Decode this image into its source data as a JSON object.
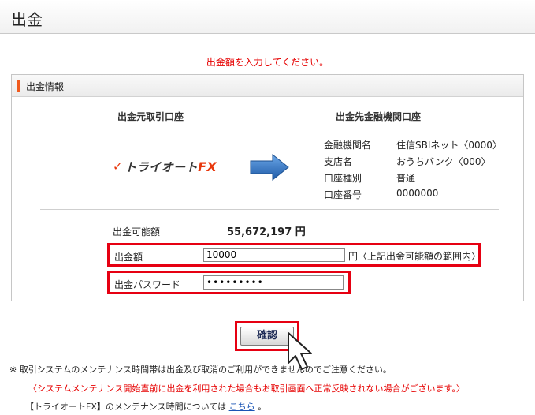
{
  "page": {
    "title": "出金"
  },
  "instruction": "出金額を入力してください。",
  "panel": {
    "title": "出金情報",
    "source_header": "出金元取引口座",
    "dest_header": "出金先金融機関口座",
    "logo": {
      "brand": "トライオート",
      "suffix": "FX"
    },
    "bank": [
      {
        "key": "金融機関名",
        "value": "住信SBIネット〈0000〉"
      },
      {
        "key": "支店名",
        "value": "おうちバンク〈000〉"
      },
      {
        "key": "口座種別",
        "value": "普通"
      },
      {
        "key": "口座番号",
        "value": "0000000"
      }
    ],
    "available_label": "出金可能額",
    "available_value": "55,672,197 円",
    "amount_label": "出金額",
    "amount_value": "10000",
    "amount_unit_note": "円〈上記出金可能額の範囲内〉",
    "password_label": "出金パスワード",
    "password_value": "•••••••••"
  },
  "confirm_label": "確認",
  "notes": {
    "line1": "※ 取引システムのメンテナンス時間帯は出金及び取消のご利用ができませんのでご注意ください。",
    "line2": "〈システムメンテナンス開始直前に出金を利用された場合もお取引画面へ正常反映されない場合がございます。〉",
    "line3_prefix": "【トライオートFX】のメンテナンス時間については",
    "line3_link": "こちら",
    "line3_suffix": "。"
  },
  "colors": {
    "accent_red": "#e60012",
    "header_bar": "#f05a1e",
    "arrow_blue": "#2a6fc0",
    "link": "#1a55b5"
  }
}
